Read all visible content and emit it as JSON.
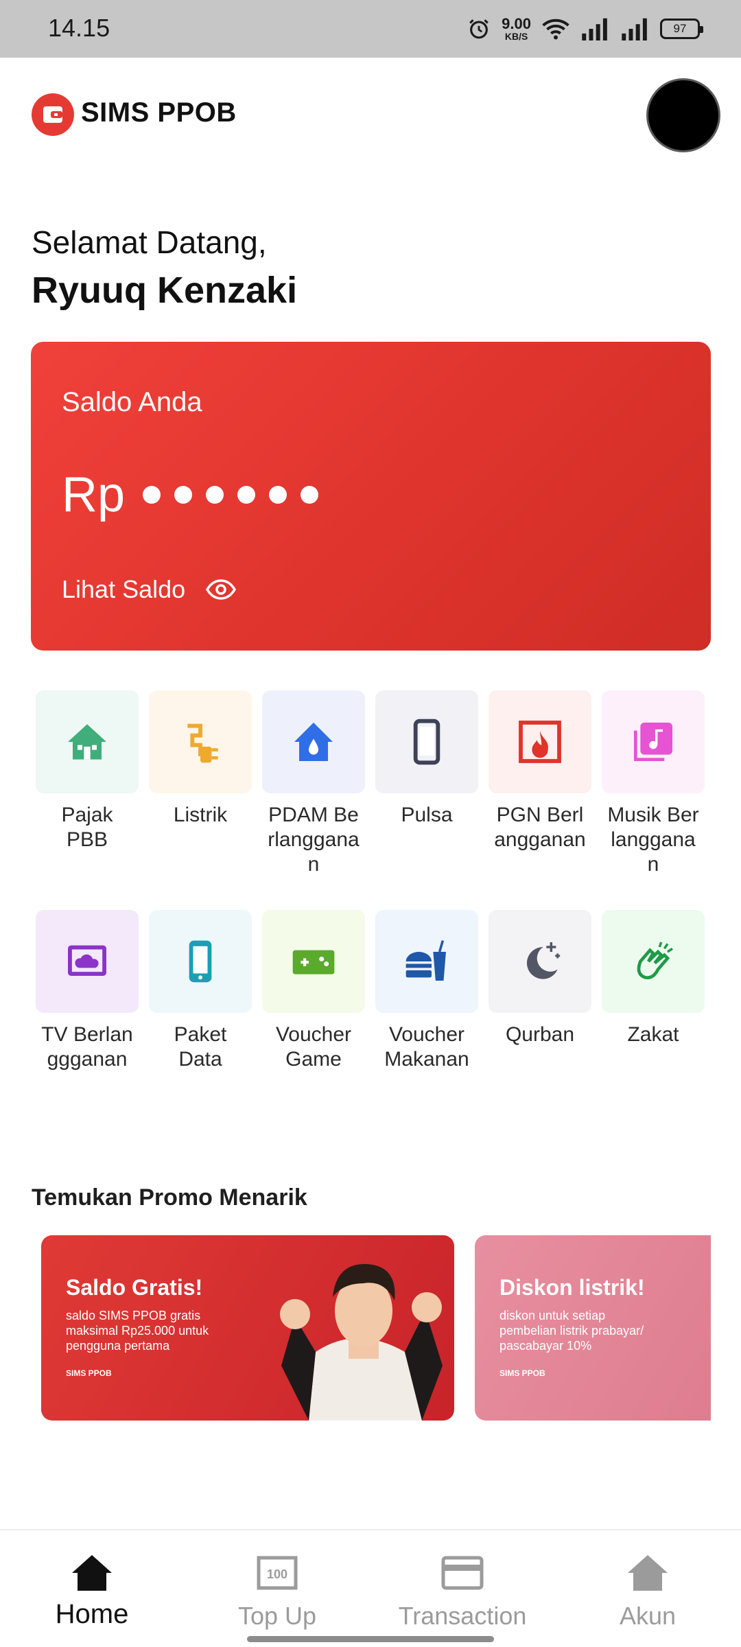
{
  "status_bar": {
    "time": "14.15",
    "speed_value": "9.00",
    "speed_unit": "KB/S",
    "battery": "97"
  },
  "header": {
    "brand": "SIMS PPOB"
  },
  "greeting": {
    "line1": "Selamat Datang,",
    "name": "Ryuuq Kenzaki"
  },
  "balance_card": {
    "label": "Saldo Anda",
    "currency": "Rp",
    "view_label": "Lihat Saldo"
  },
  "services": [
    {
      "label": "Pajak\nPBB",
      "icon": "house-icon",
      "bg": "#eef8f4",
      "color": "#3fae7a"
    },
    {
      "label": "Listrik",
      "icon": "plug-icon",
      "bg": "#fef6ea",
      "color": "#f0a92d"
    },
    {
      "label": "PDAM Be\nrlanggana\nn",
      "icon": "water-drop-house-icon",
      "bg": "#eef1fc",
      "color": "#2f6ee6"
    },
    {
      "label": "Pulsa",
      "icon": "phone-icon",
      "bg": "#f1f1f6",
      "color": "#3d4257"
    },
    {
      "label": "PGN Berl\nangganan",
      "icon": "gas-flame-icon",
      "bg": "#fdf0ef",
      "color": "#e0342b"
    },
    {
      "label": "Musik Ber\nlanggana\nn",
      "icon": "music-icon",
      "bg": "#fdf0fb",
      "color": "#e653d3"
    },
    {
      "label": "TV Berlan\nggganan",
      "icon": "tv-cloud-icon",
      "bg": "#f3e9fb",
      "color": "#8a34c8"
    },
    {
      "label": "Paket\nData",
      "icon": "mobile-data-icon",
      "bg": "#eef8fb",
      "color": "#1b9fb2"
    },
    {
      "label": "Voucher\nGame",
      "icon": "gamepad-icon",
      "bg": "#f4fbe9",
      "color": "#5aaa2c"
    },
    {
      "label": "Voucher\nMakanan",
      "icon": "burger-drink-icon",
      "bg": "#eef5fc",
      "color": "#1f58a8"
    },
    {
      "label": "Qurban",
      "icon": "moon-star-icon",
      "bg": "#f3f3f5",
      "color": "#535665"
    },
    {
      "label": "Zakat",
      "icon": "clapping-hands-icon",
      "bg": "#edfbef",
      "color": "#1f9a48"
    }
  ],
  "promo": {
    "title": "Temukan Promo Menarik",
    "items": [
      {
        "heading": "Saldo Gratis!",
        "body": "saldo SIMS PPOB gratis\nmaksimal Rp25.000 untuk\npengguna pertama",
        "brand": "SIMS PPOB"
      },
      {
        "heading": "Diskon listrik!",
        "body": "diskon untuk setiap\npembelian listrik prabayar/\npascabayar 10%",
        "brand": "SIMS PPOB"
      }
    ]
  },
  "nav": {
    "home": "Home",
    "topup": "Top Up",
    "transaction": "Transaction",
    "account": "Akun"
  },
  "colors": {
    "brand_red": "#e53a33",
    "active_nav": "#111111",
    "inactive_nav": "#9b9b9b"
  }
}
